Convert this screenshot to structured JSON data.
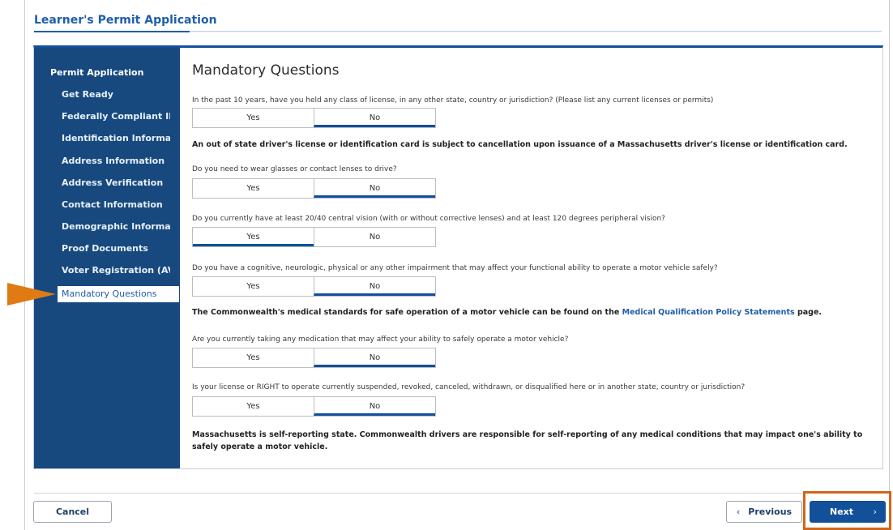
{
  "app": {
    "title": "Learner's Permit Application"
  },
  "sidebar": {
    "heading": "Permit Application",
    "items": [
      {
        "label": "Get Ready"
      },
      {
        "label": "Federally Compliant ID"
      },
      {
        "label": "Identification Information"
      },
      {
        "label": "Address Information"
      },
      {
        "label": "Address Verification"
      },
      {
        "label": "Contact Information"
      },
      {
        "label": "Demographic Information"
      },
      {
        "label": "Proof Documents"
      },
      {
        "label": "Voter Registration (AVR)"
      },
      {
        "label": "Mandatory Questions",
        "active": true
      }
    ]
  },
  "main": {
    "title": "Mandatory Questions",
    "questions": [
      {
        "text": "In the past 10 years, have you held any class of license, in any other state, country or jurisdiction? (Please list any current licenses or permits)",
        "yes": "Yes",
        "no": "No",
        "selected": "no"
      },
      {
        "text": "Do you need to wear glasses or contact lenses to drive?",
        "yes": "Yes",
        "no": "No",
        "selected": "no"
      },
      {
        "text": "Do you currently have at least 20/40 central vision (with or without corrective lenses) and at least 120 degrees peripheral vision?",
        "yes": "Yes",
        "no": "No",
        "selected": "yes"
      },
      {
        "text": "Do you have a cognitive, neurologic, physical or any other impairment that may affect your functional ability to operate a motor vehicle safely?",
        "yes": "Yes",
        "no": "No",
        "selected": "no"
      },
      {
        "text": "Are you currently taking any medication that may affect your ability to safely operate a motor vehicle?",
        "yes": "Yes",
        "no": "No",
        "selected": "no"
      },
      {
        "text": "Is your license or RIGHT to operate currently suspended, revoked, canceled, withdrawn, or disqualified here or in another state, country or jurisdiction?",
        "yes": "Yes",
        "no": "No",
        "selected": "no"
      }
    ],
    "notes": {
      "out_of_state": "An out of state driver's license or identification card is subject to cancellation upon issuance of a Massachusetts driver's license or identification card.",
      "medical_prefix": "The Commonwealth's medical standards for safe operation of a motor vehicle can be found on the",
      "medical_link": "Medical Qualification Policy Statements",
      "medical_suffix": "page.",
      "self_reporting": "Massachusetts is self-reporting state. Commonwealth drivers are responsible for self-reporting of any medical conditions that may impact one's ability to safely operate a motor vehicle."
    }
  },
  "footer": {
    "cancel": "Cancel",
    "previous": "Previous",
    "next": "Next"
  },
  "icons": {
    "prev": "chevron-left-icon",
    "next": "chevron-right-icon",
    "pointer": "arrow-pointer"
  },
  "colors": {
    "accent": "#12509a",
    "sidebar": "#17497f",
    "highlight": "#d0661a",
    "pointer": "#e07a14"
  }
}
